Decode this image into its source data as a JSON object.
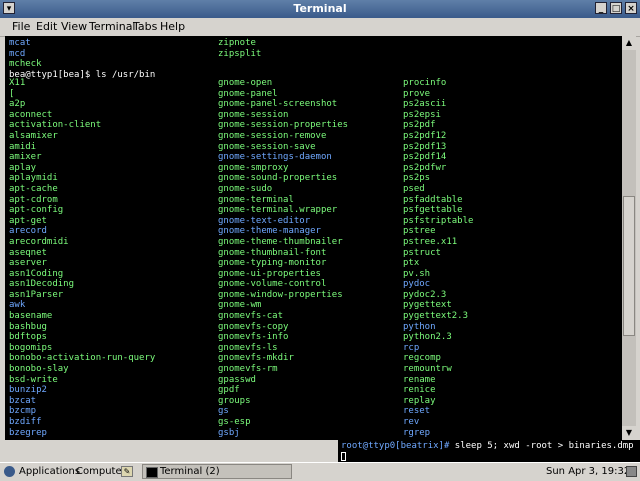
{
  "window": {
    "title": "Terminal"
  },
  "menubar": {
    "items": [
      "File",
      "Edit",
      "View",
      "Terminal",
      "Tabs",
      "Help"
    ]
  },
  "terminal": {
    "pre_lines": [
      [
        "mcat",
        "zipnote"
      ],
      [
        "mcd",
        "zipsplit"
      ],
      [
        "mcheck",
        ""
      ]
    ],
    "prompt": "bea@ttyp1[bea]$ ls /usr/bin",
    "col1": [
      "X11",
      "[",
      "a2p",
      "aconnect",
      "activation-client",
      "alsamixer",
      "amidi",
      "amixer",
      "aplay",
      "aplaymidi",
      "apt-cache",
      "apt-cdrom",
      "apt-config",
      "apt-get",
      "arecord",
      "arecordmidi",
      "aseqnet",
      "aserver",
      "asn1Coding",
      "asn1Decoding",
      "asn1Parser",
      "awk",
      "basename",
      "bashbug",
      "bdftops",
      "bogomips",
      "bonobo-activation-run-query",
      "bonobo-slay",
      "bsd-write",
      "bunzip2",
      "bzcat",
      "bzcmp",
      "bzdiff",
      "bzegrep"
    ],
    "col2": [
      "gnome-open",
      "gnome-panel",
      "gnome-panel-screenshot",
      "gnome-session",
      "gnome-session-properties",
      "gnome-session-remove",
      "gnome-session-save",
      "gnome-settings-daemon",
      "gnome-smproxy",
      "gnome-sound-properties",
      "gnome-sudo",
      "gnome-terminal",
      "gnome-terminal.wrapper",
      "gnome-text-editor",
      "gnome-theme-manager",
      "gnome-theme-thumbnailer",
      "gnome-thumbnail-font",
      "gnome-typing-monitor",
      "gnome-ui-properties",
      "gnome-volume-control",
      "gnome-window-properties",
      "gnome-wm",
      "gnomevfs-cat",
      "gnomevfs-copy",
      "gnomevfs-info",
      "gnomevfs-ls",
      "gnomevfs-mkdir",
      "gnomevfs-rm",
      "gpasswd",
      "gpdf",
      "groups",
      "gs",
      "gs-esp",
      "gsbj"
    ],
    "col3": [
      "procinfo",
      "prove",
      "ps2ascii",
      "ps2epsi",
      "ps2pdf",
      "ps2pdf12",
      "ps2pdf13",
      "ps2pdf14",
      "ps2pdfwr",
      "ps2ps",
      "psed",
      "psfaddtable",
      "psfgettable",
      "psfstriptable",
      "pstree",
      "pstree.x11",
      "pstruct",
      "ptx",
      "pv.sh",
      "pydoc",
      "pydoc2.3",
      "pygettext",
      "pygettext2.3",
      "python",
      "python2.3",
      "rcp",
      "regcomp",
      "remountrw",
      "rename",
      "renice",
      "replay",
      "reset",
      "rev",
      "rgrep"
    ]
  },
  "overlay": {
    "prompt": "root@ttyp0[beatrix]#",
    "command": " sleep 5; xwd -root > binaries.dmp"
  },
  "panel": {
    "applications": "Applications",
    "computer": "Computer",
    "task": "Terminal (2)",
    "clock": "Sun Apr  3, 19:32"
  }
}
